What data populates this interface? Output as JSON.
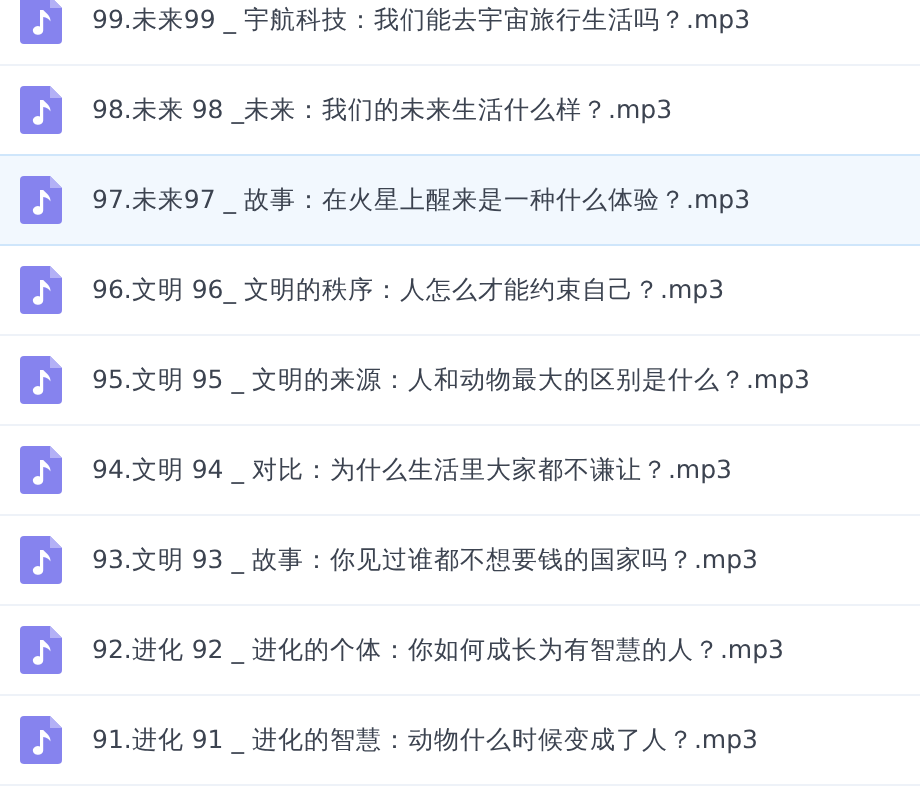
{
  "files": [
    {
      "name": "99.未来99 _ 宇航科技：我们能去宇宙旅行生活吗？.mp3",
      "selected": false
    },
    {
      "name": "98.未来 98 _未来：我们的未来生活什么样？.mp3",
      "selected": false
    },
    {
      "name": "97.未来97 _ 故事：在火星上醒来是一种什么体验？.mp3",
      "selected": true
    },
    {
      "name": "96.文明 96_ 文明的秩序：人怎么才能约束自己？.mp3",
      "selected": false
    },
    {
      "name": "95.文明 95 _ 文明的来源：人和动物最大的区别是什么？.mp3",
      "selected": false
    },
    {
      "name": "94.文明 94 _ 对比：为什么生活里大家都不谦让？.mp3",
      "selected": false
    },
    {
      "name": "93.文明 93 _ 故事：你见过谁都不想要钱的国家吗？.mp3",
      "selected": false
    },
    {
      "name": "92.进化 92 _ 进化的个体：你如何成长为有智慧的人？.mp3",
      "selected": false
    },
    {
      "name": "91.进化 91 _ 进化的智慧：动物什么时候变成了人？.mp3",
      "selected": false
    }
  ]
}
